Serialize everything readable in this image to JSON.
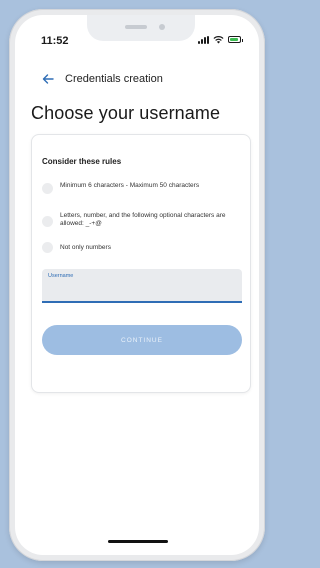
{
  "status_bar": {
    "time": "11:52"
  },
  "app_bar": {
    "back_icon": "arrow-left-icon",
    "title": "Credentials creation"
  },
  "page": {
    "title": "Choose your username"
  },
  "rules": {
    "heading": "Consider these rules",
    "items": [
      {
        "text": "Minimum 6 characters - Maximum 50 characters"
      },
      {
        "text": "Letters, number, and the following optional characters are allowed: _-+@"
      },
      {
        "text": "Not only numbers"
      }
    ]
  },
  "username_field": {
    "label": "Username",
    "value": "",
    "placeholder": ""
  },
  "continue_button": {
    "label": "CONTINUE"
  },
  "colors": {
    "accent": "#2f6db5",
    "button_disabled": "#9dbde2",
    "background": "#a9c1dd"
  }
}
